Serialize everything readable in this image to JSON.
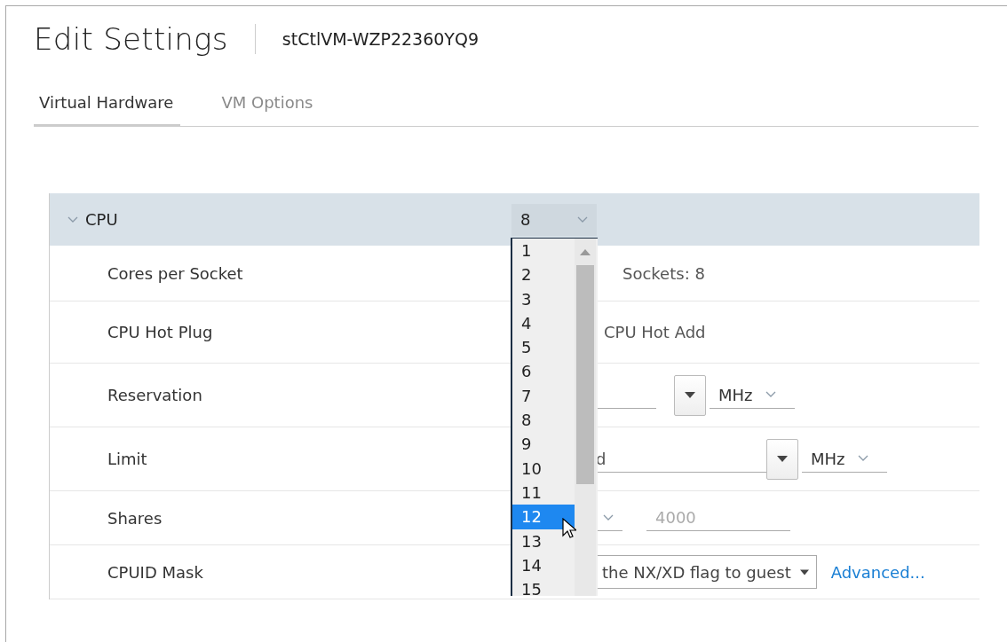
{
  "dialog": {
    "title": "Edit Settings",
    "vm_name": "stCtlVM-WZP22360YQ9"
  },
  "tabs": [
    {
      "label": "Virtual Hardware",
      "selected": true
    },
    {
      "label": "VM Options",
      "selected": false
    }
  ],
  "section": {
    "label": "CPU",
    "expanded": true,
    "value": "8"
  },
  "rows": [
    {
      "kind": "sockets",
      "label": "Cores per Socket",
      "text": "Sockets: 8"
    },
    {
      "kind": "checkbox",
      "label": "CPU Hot Plug",
      "text": "CPU Hot Add"
    },
    {
      "kind": "reservation",
      "label": "Reservation",
      "unit": "MHz"
    },
    {
      "kind": "limit",
      "label": "Limit",
      "value": "d",
      "unit": "MHz"
    },
    {
      "kind": "shares",
      "label": "Shares",
      "value": "4000",
      "disabled": true
    },
    {
      "kind": "mask",
      "label": "CPUID Mask",
      "value": "the NX/XD flag to guest",
      "link": "Advanced..."
    }
  ],
  "dropdown": {
    "options": [
      {
        "label": "1",
        "selected": false
      },
      {
        "label": "2",
        "selected": false
      },
      {
        "label": "3",
        "selected": false
      },
      {
        "label": "4",
        "selected": false
      },
      {
        "label": "5",
        "selected": false
      },
      {
        "label": "6",
        "selected": false
      },
      {
        "label": "7",
        "selected": false
      },
      {
        "label": "8",
        "selected": false
      },
      {
        "label": "9",
        "selected": false
      },
      {
        "label": "10",
        "selected": false
      },
      {
        "label": "11",
        "selected": false
      },
      {
        "label": "12",
        "selected": true
      },
      {
        "label": "13",
        "selected": false
      },
      {
        "label": "14",
        "selected": false
      },
      {
        "label": "15",
        "selected": false
      }
    ]
  }
}
